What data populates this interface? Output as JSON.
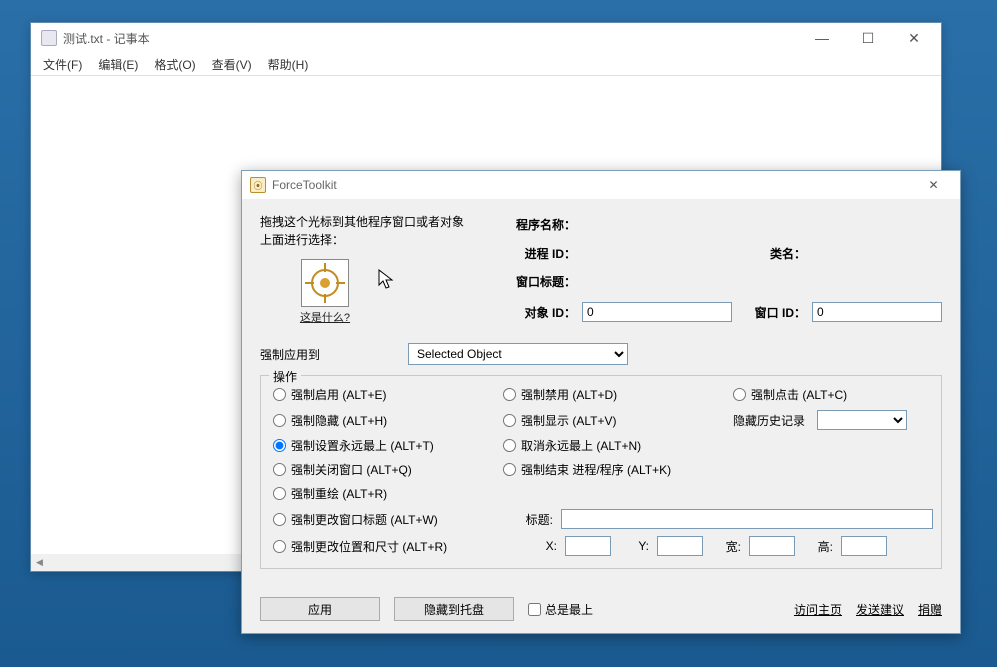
{
  "notepad": {
    "title": "测试.txt - 记事本",
    "menu": {
      "file": "文件(F)",
      "edit": "编辑(E)",
      "format": "格式(O)",
      "view": "查看(V)",
      "help": "帮助(H)"
    }
  },
  "ft": {
    "title": "ForceToolkit",
    "drag_text": "拖拽这个光标到其他程序窗口或者对象上面进行选择：",
    "whatis": "这是什么?",
    "labels": {
      "program_name": "程序名称：",
      "process_id": "进程 ID：",
      "window_title": "窗口标题：",
      "object_id": "对象 ID：",
      "class_name": "类名：",
      "window_id": "窗口 ID："
    },
    "values": {
      "object_id": "0",
      "window_id": "0"
    },
    "apply_to_label": "强制应用到",
    "apply_to_value": "Selected Object",
    "ops": {
      "group_label": "操作",
      "enable": "强制启用 (ALT+E)",
      "hide": "强制隐藏 (ALT+H)",
      "topmost": "强制设置永远最上 (ALT+T)",
      "close": "强制关闭窗口 (ALT+Q)",
      "redraw": "强制重绘 (ALT+R)",
      "change_title": "强制更改窗口标题 (ALT+W)",
      "change_pos": "强制更改位置和尺寸 (ALT+R)",
      "disable": "强制禁用 (ALT+D)",
      "show": "强制显示 (ALT+V)",
      "cancel_topmost": "取消永远最上 (ALT+N)",
      "kill": "强制结束 进程/程序 (ALT+K)",
      "click": "强制点击 (ALT+C)",
      "hide_history": "隐藏历史记录",
      "title_label": "标题:",
      "x": "X:",
      "y": "Y:",
      "w": "宽:",
      "h": "高:"
    },
    "bottom": {
      "apply": "应用",
      "hide_to_tray": "隐藏到托盘",
      "always_top": "总是最上",
      "visit": "访问主页",
      "suggest": "发送建议",
      "donate": "捐赠"
    }
  }
}
